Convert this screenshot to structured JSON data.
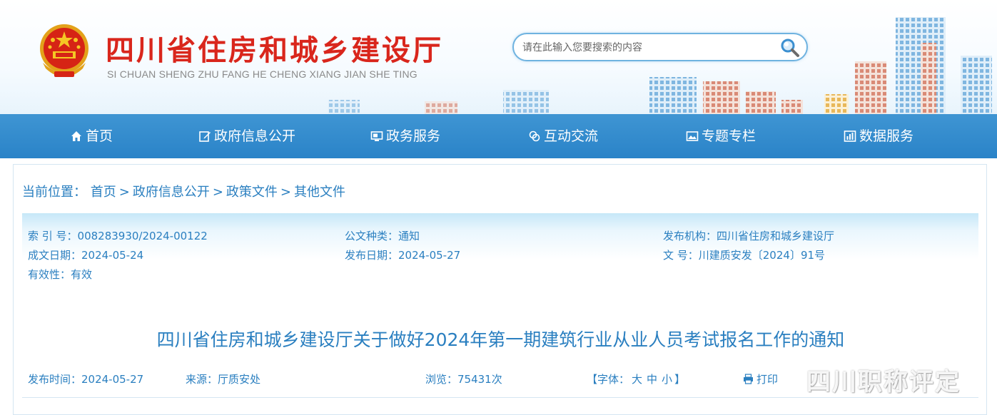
{
  "header": {
    "site_title": "四川省住房和城乡建设厅",
    "site_pinyin": "SI CHUAN SHENG ZHU FANG HE CHENG XIANG JIAN SHE TING",
    "search": {
      "placeholder": "请在此输入您要搜索的内容",
      "value": ""
    }
  },
  "nav": {
    "items": [
      {
        "label": "首页",
        "icon": "home-icon"
      },
      {
        "label": "政府信息公开",
        "icon": "edit-icon"
      },
      {
        "label": "政务服务",
        "icon": "monitor-icon"
      },
      {
        "label": "互动交流",
        "icon": "interaction-icon"
      },
      {
        "label": "专题专栏",
        "icon": "image-icon"
      },
      {
        "label": "数据服务",
        "icon": "chart-icon"
      }
    ]
  },
  "breadcrumb": {
    "label": "当前位置：",
    "items": [
      "首页",
      "政府信息公开",
      "政策文件",
      "其他文件"
    ],
    "separator": ">"
  },
  "meta": {
    "index_no": "索 引 号：008283930/2024-00122",
    "doc_type": "公文种类：通知",
    "publisher": "发布机构：四川省住房和城乡建设厅",
    "created_date": "成文日期：2024-05-24",
    "publish_date": "发布日期：2024-05-27",
    "doc_no": "文 号：川建质安发〔2024〕91号",
    "validity": "有效性：有效"
  },
  "document": {
    "title": "四川省住房和城乡建设厅关于做好2024年第一期建筑行业从业人员考试报名工作的通知",
    "publish_time": "发布时间：2024-05-27",
    "source": "来源：厅质安处",
    "views": "浏览：75431次",
    "font_label": "【字体：",
    "font_sizes": [
      "大",
      "中",
      "小"
    ],
    "font_close": "】",
    "print_label": "打印"
  },
  "watermark": "四川职称评定",
  "colors": {
    "nav_bg": "#2a83c8",
    "accent_text": "#2a7fc0",
    "title_red": "#d9261c"
  }
}
